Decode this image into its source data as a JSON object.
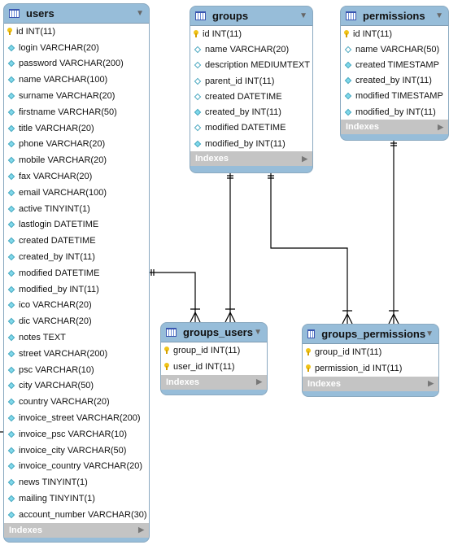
{
  "indexes_label": "Indexes",
  "tables": [
    {
      "name": "users",
      "columns": [
        {
          "k": "pk",
          "t": "id INT(11)"
        },
        {
          "k": "nn",
          "t": "login VARCHAR(20)"
        },
        {
          "k": "nn",
          "t": "password VARCHAR(200)"
        },
        {
          "k": "nn",
          "t": "name VARCHAR(100)"
        },
        {
          "k": "nn",
          "t": "surname VARCHAR(20)"
        },
        {
          "k": "nn",
          "t": "firstname VARCHAR(50)"
        },
        {
          "k": "nn",
          "t": "title VARCHAR(20)"
        },
        {
          "k": "nn",
          "t": "phone VARCHAR(20)"
        },
        {
          "k": "nn",
          "t": "mobile VARCHAR(20)"
        },
        {
          "k": "nn",
          "t": "fax VARCHAR(20)"
        },
        {
          "k": "nn",
          "t": "email VARCHAR(100)"
        },
        {
          "k": "nn",
          "t": "active TINYINT(1)"
        },
        {
          "k": "nn",
          "t": "lastlogin DATETIME"
        },
        {
          "k": "nn",
          "t": "created DATETIME"
        },
        {
          "k": "nn",
          "t": "created_by INT(11)"
        },
        {
          "k": "nn",
          "t": "modified DATETIME"
        },
        {
          "k": "nn",
          "t": "modified_by INT(11)"
        },
        {
          "k": "nn",
          "t": "ico VARCHAR(20)"
        },
        {
          "k": "nn",
          "t": "dic VARCHAR(20)"
        },
        {
          "k": "nn",
          "t": "notes TEXT"
        },
        {
          "k": "nn",
          "t": "street VARCHAR(200)"
        },
        {
          "k": "nn",
          "t": "psc VARCHAR(10)"
        },
        {
          "k": "nn",
          "t": "city VARCHAR(50)"
        },
        {
          "k": "nn",
          "t": "country VARCHAR(20)"
        },
        {
          "k": "nn",
          "t": "invoice_street VARCHAR(200)"
        },
        {
          "k": "nn",
          "t": "invoice_psc VARCHAR(10)"
        },
        {
          "k": "nn",
          "t": "invoice_city VARCHAR(50)"
        },
        {
          "k": "nn",
          "t": "invoice_country VARCHAR(20)"
        },
        {
          "k": "nn",
          "t": "news TINYINT(1)"
        },
        {
          "k": "nn",
          "t": "mailing TINYINT(1)"
        },
        {
          "k": "nn",
          "t": "account_number VARCHAR(30)"
        }
      ]
    },
    {
      "name": "groups",
      "columns": [
        {
          "k": "pk",
          "t": "id INT(11)"
        },
        {
          "k": "null",
          "t": "name VARCHAR(20)"
        },
        {
          "k": "null",
          "t": "description MEDIUMTEXT"
        },
        {
          "k": "null",
          "t": "parent_id INT(11)"
        },
        {
          "k": "null",
          "t": "created DATETIME"
        },
        {
          "k": "nn",
          "t": "created_by INT(11)"
        },
        {
          "k": "null",
          "t": "modified DATETIME"
        },
        {
          "k": "nn",
          "t": "modified_by INT(11)"
        }
      ]
    },
    {
      "name": "permissions",
      "columns": [
        {
          "k": "pk",
          "t": "id INT(11)"
        },
        {
          "k": "null",
          "t": "name VARCHAR(50)"
        },
        {
          "k": "nn",
          "t": "created TIMESTAMP"
        },
        {
          "k": "nn",
          "t": "created_by INT(11)"
        },
        {
          "k": "nn",
          "t": "modified TIMESTAMP"
        },
        {
          "k": "nn",
          "t": "modified_by INT(11)"
        }
      ]
    },
    {
      "name": "groups_users",
      "columns": [
        {
          "k": "pk",
          "t": "group_id INT(11)"
        },
        {
          "k": "pk",
          "t": "user_id INT(11)"
        }
      ]
    },
    {
      "name": "groups_permissions",
      "columns": [
        {
          "k": "pk",
          "t": "group_id INT(11)"
        },
        {
          "k": "pk",
          "t": "permission_id INT(11)"
        }
      ]
    }
  ]
}
